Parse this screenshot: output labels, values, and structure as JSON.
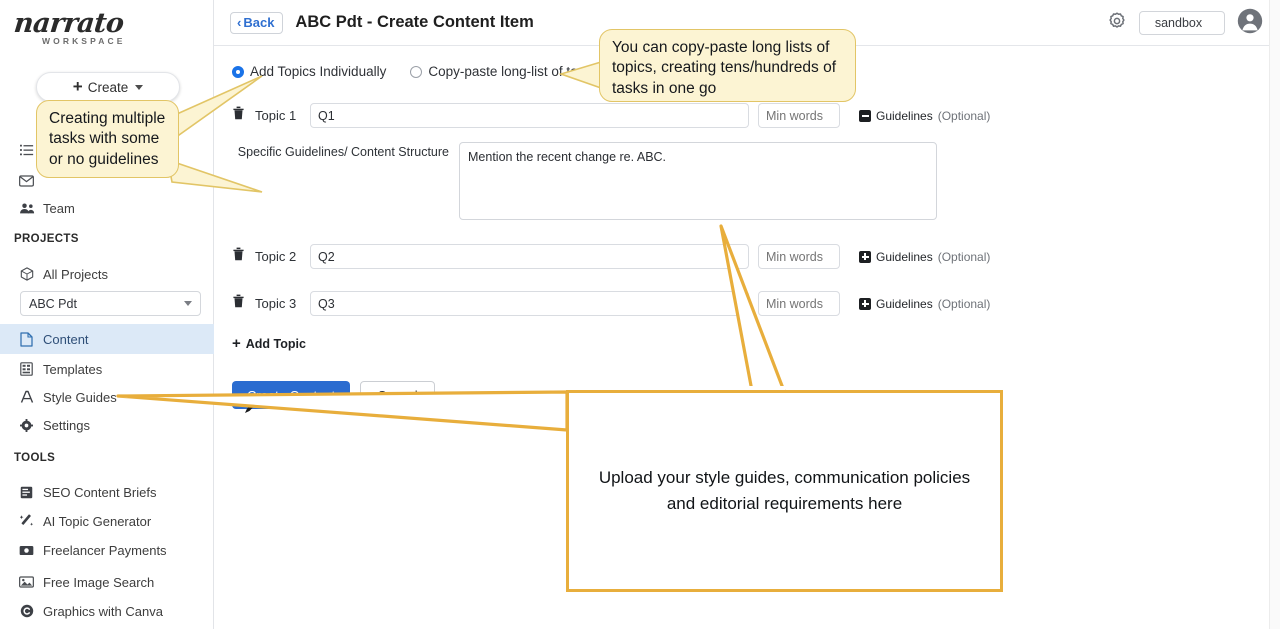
{
  "brand": {
    "name": "narrato",
    "subtitle": "WORKSPACE",
    "accent_blue": "#2b6cd0",
    "callout_yellow_fill": "#fcf4d3",
    "callout_yellow_border": "#e2c566",
    "callout_white_border": "#e8ae3c",
    "active_nav_bg": "#dce9f7"
  },
  "sidebar": {
    "create_button": "Create",
    "hidden_items": [
      {
        "icon": "list-icon",
        "label": ""
      },
      {
        "icon": "envelope-icon",
        "label": ""
      }
    ],
    "top_items": [
      {
        "icon": "team-icon",
        "label": "Team"
      }
    ],
    "projects_section": "PROJECTS",
    "all_projects": "All Projects",
    "project_select_value": "ABC Pdt",
    "project_items": [
      {
        "icon": "document-icon",
        "label": "Content",
        "active": true
      },
      {
        "icon": "template-icon",
        "label": "Templates",
        "active": false
      },
      {
        "icon": "font-icon",
        "label": "Style Guides",
        "active": false
      },
      {
        "icon": "gear-icon",
        "label": "Settings",
        "active": false
      }
    ],
    "tools_section": "TOOLS",
    "tools_items": [
      {
        "icon": "brief-icon",
        "label": "SEO Content Briefs"
      },
      {
        "icon": "magic-wand-icon",
        "label": "AI Topic Generator"
      },
      {
        "icon": "money-icon",
        "label": "Freelancer Payments"
      },
      {
        "icon": "image-icon",
        "label": "Free Image Search"
      },
      {
        "icon": "canva-icon",
        "label": "Graphics with Canva"
      }
    ]
  },
  "topbar": {
    "back_label": "Back",
    "page_title": "ABC Pdt - Create Content Item",
    "env_label": "sandbox"
  },
  "form": {
    "mode_individually": "Add Topics Individually",
    "mode_copy_paste": "Copy-paste long-list of topics",
    "guidelines_label": "Guidelines",
    "guidelines_optional": "(Optional)",
    "min_words_placeholder": "Min words",
    "specific_guidelines_label": "Specific Guidelines/ Content Structure",
    "specific_guidelines_value": "Mention the recent change re. ABC.",
    "topics": [
      {
        "label": "Topic 1",
        "value": "Q1",
        "expanded": true
      },
      {
        "label": "Topic 2",
        "value": "Q2",
        "expanded": false
      },
      {
        "label": "Topic 3",
        "value": "Q3",
        "expanded": false
      }
    ],
    "add_topic": "Add Topic",
    "create_content_button": "Create Content",
    "cancel_button": "Cancel"
  },
  "annotations": {
    "left_callout": "Creating multiple tasks with some or no guidelines",
    "top_callout": "You can copy-paste long lists of topics, creating tens/hundreds of tasks in one go",
    "bottom_callout": "Upload your style guides, communication policies and editorial requirements here"
  }
}
